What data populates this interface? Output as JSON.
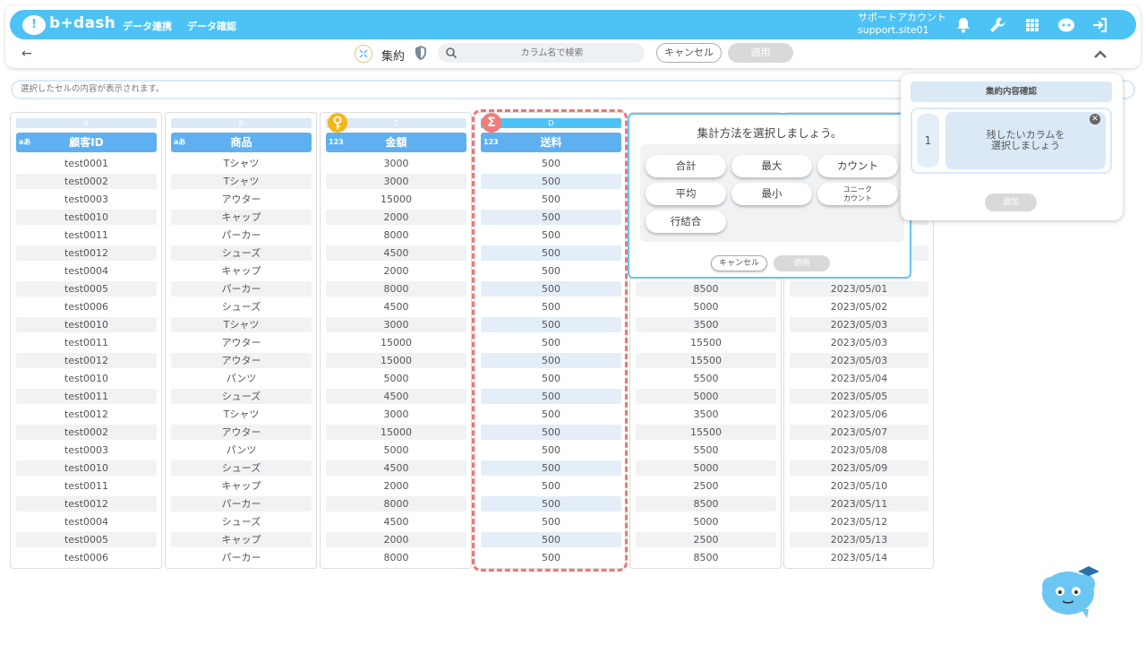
{
  "header": {
    "logo_text": "b+dash",
    "logo_mark": "!",
    "nav": [
      "データ連携",
      "データ確認"
    ],
    "account_name": "サポートアカウント",
    "account_id": "support.site01"
  },
  "toolbar": {
    "back_label": "←",
    "title": "集約",
    "search_placeholder": "カラム名で検索",
    "cancel_label": "キャンセル",
    "apply_label": "適用"
  },
  "cell_bar": {
    "placeholder": "選択したセルの内容が表示されます。"
  },
  "columns": [
    {
      "letter": "A",
      "type": "aあ",
      "name": "顧客ID",
      "values": [
        "test0001",
        "test0002",
        "test0003",
        "test0010",
        "test0011",
        "test0012",
        "test0004",
        "test0005",
        "test0006",
        "test0010",
        "test0011",
        "test0012",
        "test0010",
        "test0011",
        "test0012",
        "test0002",
        "test0003",
        "test0010",
        "test0011",
        "test0012",
        "test0004",
        "test0005",
        "test0006"
      ]
    },
    {
      "letter": "B",
      "type": "aあ",
      "name": "商品",
      "values": [
        "Tシャツ",
        "Tシャツ",
        "アウター",
        "キャップ",
        "パーカー",
        "シューズ",
        "キャップ",
        "パーカー",
        "シューズ",
        "Tシャツ",
        "アウター",
        "アウター",
        "パンツ",
        "シューズ",
        "Tシャツ",
        "アウター",
        "パンツ",
        "シューズ",
        "キャップ",
        "パーカー",
        "シューズ",
        "キャップ",
        "パーカー"
      ]
    },
    {
      "letter": "C",
      "type": "123",
      "name": "金額",
      "values": [
        "3000",
        "3000",
        "15000",
        "2000",
        "8000",
        "4500",
        "2000",
        "8000",
        "4500",
        "3000",
        "15000",
        "15000",
        "5000",
        "4500",
        "3000",
        "15000",
        "5000",
        "4500",
        "2000",
        "8000",
        "4500",
        "2000",
        "8000"
      ]
    },
    {
      "letter": "D",
      "type": "123",
      "name": "送料",
      "values": [
        "500",
        "500",
        "500",
        "500",
        "500",
        "500",
        "500",
        "500",
        "500",
        "500",
        "500",
        "500",
        "500",
        "500",
        "500",
        "500",
        "500",
        "500",
        "500",
        "500",
        "500",
        "500",
        "500"
      ]
    },
    {
      "letter": "",
      "type": "",
      "name": "",
      "values": [
        "",
        "",
        "",
        "",
        "",
        "",
        "",
        "8500",
        "5000",
        "3500",
        "15500",
        "15500",
        "5500",
        "5000",
        "3500",
        "15500",
        "5500",
        "5000",
        "2500",
        "8500",
        "5000",
        "2500",
        "8500"
      ]
    },
    {
      "letter": "",
      "type": "",
      "name": "",
      "values": [
        "",
        "",
        "",
        "",
        "",
        "",
        "",
        "2023/05/01",
        "2023/05/02",
        "2023/05/03",
        "2023/05/03",
        "2023/05/03",
        "2023/05/04",
        "2023/05/05",
        "2023/05/06",
        "2023/05/07",
        "2023/05/08",
        "2023/05/09",
        "2023/05/10",
        "2023/05/11",
        "2023/05/12",
        "2023/05/13",
        "2023/05/14"
      ]
    }
  ],
  "popup": {
    "title": "集計方法を選択しましょう。",
    "options": [
      "合計",
      "最大",
      "カウント",
      "平均",
      "最小",
      "ユニーク\nカウント",
      "行結合"
    ],
    "cancel_label": "キャンセル",
    "apply_label": "適用"
  },
  "summary_panel": {
    "header": "集約内容確認",
    "row_number": "1",
    "hint_line1": "残したいカラムを",
    "hint_line2": "選択しましょう",
    "add_label": "追加"
  },
  "colors": {
    "accent": "#4dc3f5",
    "header_blue": "#5fb0f0",
    "highlight_red": "#f07474",
    "key_yellow": "#f7b616"
  }
}
